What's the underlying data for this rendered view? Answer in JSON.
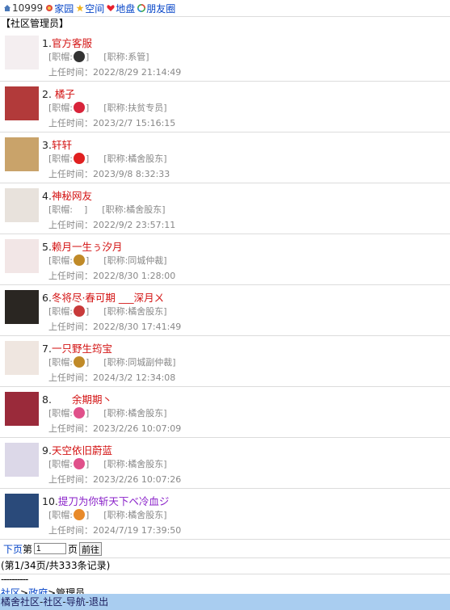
{
  "topbar": {
    "uid": "10999",
    "links": [
      {
        "label": "家园",
        "icon": "home-icon"
      },
      {
        "label": "空间",
        "icon": "star-icon"
      },
      {
        "label": "地盘",
        "icon": "heart-icon"
      },
      {
        "label": "朋友圈",
        "icon": "friends-circle-icon"
      }
    ]
  },
  "section_title": "【社区管理员】",
  "field_labels": {
    "hat": "[职帽:",
    "title_prefix": "[职称:",
    "close": "]",
    "time_prefix": "上任时间："
  },
  "managers": [
    {
      "index": "1.",
      "name": "官方客服",
      "hat_icon": "penguin-icon",
      "title": "系管",
      "time": "2022/8/29 21:14:49",
      "avatar_color": "#f4eef0"
    },
    {
      "index": "2. ",
      "name": "橘子",
      "hat_icon": "heart-badge-icon",
      "title": "扶贫专员",
      "time": "2023/2/7 15:16:15",
      "avatar_color": "#b23a3a"
    },
    {
      "index": "3.",
      "name": "轩轩",
      "hat_icon": "red-badge-icon",
      "title": "橘舍股东",
      "time": "2023/9/8 8:32:33",
      "avatar_color": "#c9a36a"
    },
    {
      "index": "4.",
      "name": "神秘网友",
      "hat_icon": "",
      "title": "橘舍股东",
      "time": "2022/9/2 23:57:11",
      "avatar_color": "#e8e2dc"
    },
    {
      "index": "5.",
      "name": "赖月一生ぅ汐月",
      "hat_icon": "scales-icon",
      "title": "同城仲裁",
      "time": "2022/8/30 1:28:00",
      "avatar_color": "#f2e6e6"
    },
    {
      "index": "6.",
      "name": "冬将尽·春可期 ___深月ㄨ",
      "hat_icon": "small-figure-icon",
      "title": "橘舍股东",
      "time": "2022/8/30 17:41:49",
      "avatar_color": "#2a2622"
    },
    {
      "index": "7.",
      "name": "一只野生筠宝",
      "hat_icon": "scales-icon",
      "title": "同城副仲裁",
      "time": "2024/3/2 12:34:08",
      "avatar_color": "#efe6e0"
    },
    {
      "index": "8.",
      "name": "　　余期期丶",
      "hat_icon": "pink-figure-icon",
      "title": "橘舍股东",
      "time": "2023/2/26 10:07:09",
      "avatar_color": "#9a2a3a"
    },
    {
      "index": "9.",
      "name": "天空依旧蔚蓝",
      "hat_icon": "pink-figure-icon",
      "title": "橘舍股东",
      "time": "2023/2/26 10:07:26",
      "avatar_color": "#dcd8e8"
    },
    {
      "index": "10.",
      "name": "提刀为你斩天下ベ冷血ジ",
      "hat_icon": "tiger-face-icon",
      "title": "橘舍股东",
      "time": "2024/7/19 17:39:50",
      "avatar_color": "#2a4a7a",
      "name_color": "purple"
    }
  ],
  "pager": {
    "next": "下页",
    "page_prefix": "第",
    "page_value": "1",
    "page_suffix": "页",
    "go": "前往"
  },
  "stats": "(第1/34页/共333条记录)",
  "divider": "----------",
  "breadcrumb": [
    {
      "label": "社区",
      "link": true
    },
    {
      "label": ">",
      "link": false
    },
    {
      "label": "政府",
      "link": true
    },
    {
      "label": ">",
      "link": false
    },
    {
      "label": "管理员",
      "link": false
    }
  ],
  "footer": {
    "parts": [
      {
        "label": "橘舍社区",
        "link": true
      },
      {
        "label": "-",
        "link": false
      },
      {
        "label": "社区",
        "link": true
      },
      {
        "label": "-",
        "link": false
      },
      {
        "label": "导航",
        "link": true
      },
      {
        "label": "-",
        "link": false
      },
      {
        "label": "退出",
        "link": true
      }
    ]
  }
}
